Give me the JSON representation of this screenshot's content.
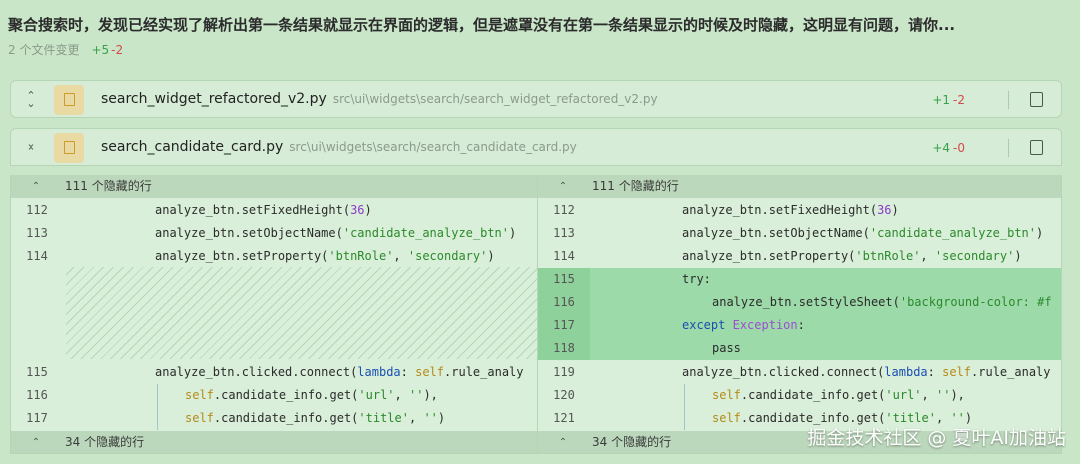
{
  "header": {
    "title": "聚合搜索时，发现已经实现了解析出第一条结果就显示在界面的逻辑，但是遮罩没有在第一条结果显示的时候及时隐藏，这明显有问题，请你...",
    "files_changed": "2 个文件变更",
    "additions": "+5",
    "deletions": "-2"
  },
  "files": [
    {
      "name": "search_widget_refactored_v2.py",
      "path": "src\\ui\\widgets\\search/search_widget_refactored_v2.py",
      "additions": "+1",
      "deletions": "-2",
      "icon": "chevron-expand-icon"
    },
    {
      "name": "search_candidate_card.py",
      "path": "src\\ui\\widgets\\search/search_candidate_card.py",
      "additions": "+4",
      "deletions": "-0",
      "icon": "chevron-collapse-icon"
    }
  ],
  "diff": {
    "hidden_top": "111 个隐藏的行",
    "hidden_bottom": "34 个隐藏的行",
    "left": {
      "ln": [
        "112",
        "113",
        "114",
        "115",
        "116",
        "117"
      ],
      "code": [
        "analyze_btn.setFixedHeight(36)",
        "analyze_btn.setObjectName('candidate_analyze_btn')",
        "analyze_btn.setProperty('btnRole', 'secondary')",
        "analyze_btn.clicked.connect(lambda: self.rule_analy",
        "self.candidate_info.get('url', ''),",
        "self.candidate_info.get('title', '')"
      ]
    },
    "right": {
      "ln": [
        "112",
        "113",
        "114",
        "115",
        "116",
        "117",
        "118",
        "119",
        "120",
        "121"
      ],
      "code": [
        "analyze_btn.setFixedHeight(36)",
        "analyze_btn.setObjectName('candidate_analyze_btn')",
        "analyze_btn.setProperty('btnRole', 'secondary')",
        "try:",
        "analyze_btn.setStyleSheet('background-color: #f",
        "except Exception:",
        "pass",
        "analyze_btn.clicked.connect(lambda: self.rule_analy",
        "self.candidate_info.get('url', ''),",
        "self.candidate_info.get('title', '')"
      ]
    }
  },
  "watermark": "掘金技术社区 @ 夏叶AI加油站",
  "colors": {
    "add": "#3aa04a",
    "del": "#d24a4a",
    "added_bg": "#9ddaa9",
    "bg": "#c9e6c9"
  }
}
